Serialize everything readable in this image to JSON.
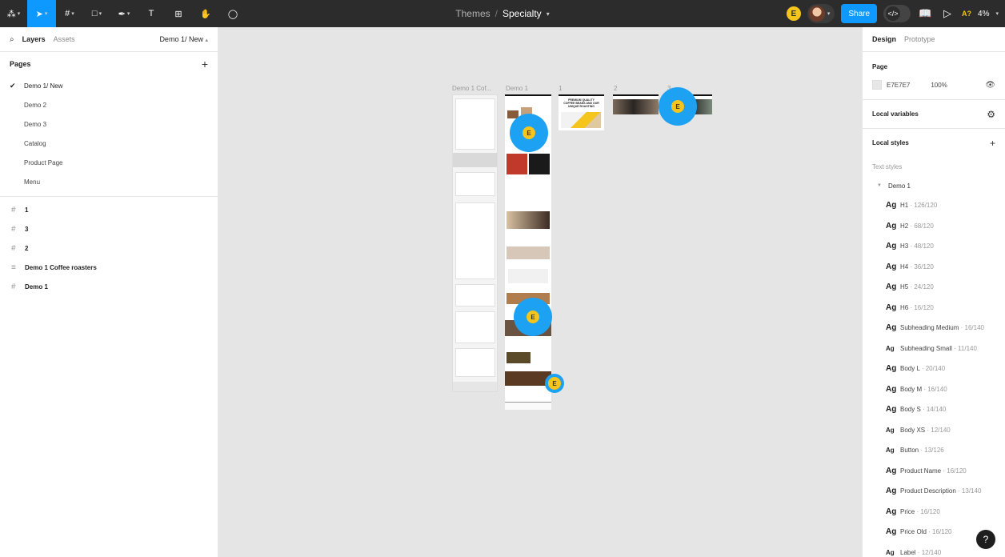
{
  "toolbar": {
    "tools": [
      {
        "name": "main-menu-icon",
        "glyph": "⁂"
      },
      {
        "name": "move-tool-icon",
        "glyph": "➤"
      },
      {
        "name": "frame-tool-icon",
        "glyph": "#"
      },
      {
        "name": "shape-tool-icon",
        "glyph": "□"
      },
      {
        "name": "pen-tool-icon",
        "glyph": "✒"
      },
      {
        "name": "text-tool-icon",
        "glyph": "T"
      },
      {
        "name": "resources-icon",
        "glyph": "⊞"
      },
      {
        "name": "hand-tool-icon",
        "glyph": "✋"
      },
      {
        "name": "comment-tool-icon",
        "glyph": "◯"
      }
    ],
    "breadcrumb": "Themes",
    "separator": "/",
    "file_title": "Specialty",
    "avatar_letter": "E",
    "share_label": "Share",
    "badge": "A?",
    "zoom": "4%",
    "colors": {
      "bar": "#2c2c2c",
      "accent": "#0d99ff"
    }
  },
  "left_panel": {
    "tabs": {
      "layers": "Layers",
      "assets": "Assets"
    },
    "page_selector": "Demo 1/ New",
    "pages_title": "Pages",
    "pages": [
      {
        "label": "Demo 1/ New",
        "current": true
      },
      {
        "label": "Demo 2"
      },
      {
        "label": "Demo 3"
      },
      {
        "label": "Catalog"
      },
      {
        "label": "Product Page"
      },
      {
        "label": "Menu"
      }
    ],
    "layers": [
      {
        "label": "1",
        "icon": "#"
      },
      {
        "label": "3",
        "icon": "#"
      },
      {
        "label": "2",
        "icon": "#"
      },
      {
        "label": "Demo 1 Coffee roasters",
        "icon": "≡"
      },
      {
        "label": "Demo 1",
        "icon": "#"
      }
    ]
  },
  "canvas": {
    "frame_labels": {
      "f1": "Demo 1 Cof...",
      "f2": "Demo 1",
      "f3": "1",
      "f4": "2",
      "f5": "3"
    },
    "small_heading": "PREMIUM QUALITY COFFEE BEANS AND OUR UNIQUE ROASTING",
    "cursor_letter": "E",
    "colors": {
      "bg": "#e5e5e5",
      "cursor": "#1da1f2",
      "avatar": "#f5c41d"
    }
  },
  "right_panel": {
    "tabs": {
      "design": "Design",
      "prototype": "Prototype"
    },
    "page_title": "Page",
    "page_color": "E7E7E7",
    "page_opacity": "100%",
    "local_variables": "Local variables",
    "local_styles": "Local styles",
    "text_styles": "Text styles",
    "group": "Demo 1",
    "styles": [
      {
        "name": "H1",
        "meta": " · 126/120",
        "big": true
      },
      {
        "name": "H2",
        "meta": " · 68/120",
        "big": true
      },
      {
        "name": "H3",
        "meta": " · 48/120",
        "big": true
      },
      {
        "name": "H4",
        "meta": " · 36/120",
        "big": true
      },
      {
        "name": "H5",
        "meta": " · 24/120",
        "big": true
      },
      {
        "name": "H6",
        "meta": " · 16/120",
        "big": true
      },
      {
        "name": "Subheading Medium",
        "meta": " · 16/140",
        "big": true
      },
      {
        "name": "Subheading Small",
        "meta": " · 11/140",
        "big": false
      },
      {
        "name": "Body L",
        "meta": " · 20/140",
        "big": true
      },
      {
        "name": "Body M",
        "meta": " · 16/140",
        "big": true
      },
      {
        "name": "Body S",
        "meta": " · 14/140",
        "big": true
      },
      {
        "name": "Body XS",
        "meta": " · 12/140",
        "big": false
      },
      {
        "name": "Button",
        "meta": " · 13/126",
        "big": false
      },
      {
        "name": "Product Name",
        "meta": " · 16/120",
        "big": true
      },
      {
        "name": "Product Description",
        "meta": " · 13/140",
        "big": true
      },
      {
        "name": "Price",
        "meta": " · 16/120",
        "big": true
      },
      {
        "name": "Price Old",
        "meta": " · 16/120",
        "big": true
      },
      {
        "name": "Label",
        "meta": " · 12/140",
        "big": false
      }
    ],
    "ag_text": "Ag",
    "help": "?"
  }
}
